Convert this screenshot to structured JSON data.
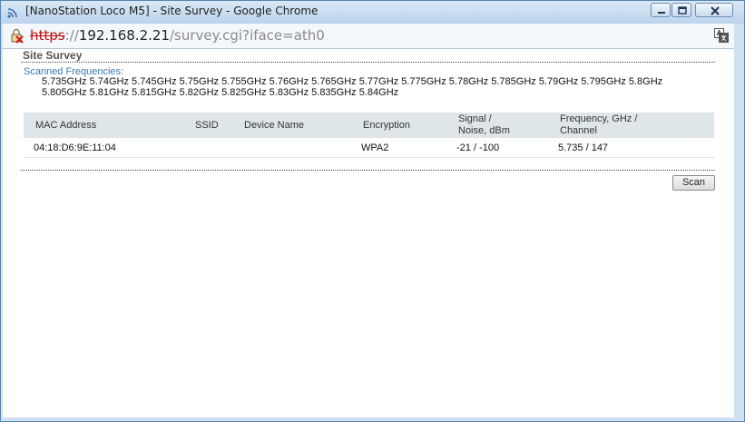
{
  "window": {
    "title": "[NanoStation Loco M5] - Site Survey - Google Chrome"
  },
  "address": {
    "scheme": "https",
    "separator": "://",
    "host": "192.168.2.21",
    "path": "/survey.cgi?iface=ath0"
  },
  "page": {
    "section_title": "Site Survey",
    "scanned_label": "Scanned Frequencies:",
    "frequencies": "5.735GHz 5.74GHz 5.745GHz 5.75GHz 5.755GHz 5.76GHz 5.765GHz 5.77GHz 5.775GHz 5.78GHz 5.785GHz 5.79GHz 5.795GHz 5.8GHz 5.805GHz 5.81GHz 5.815GHz 5.82GHz 5.825GHz 5.83GHz 5.835GHz 5.84GHz"
  },
  "table": {
    "headers": {
      "mac": "MAC Address",
      "ssid": "SSID",
      "device": "Device Name",
      "encryption": "Encryption",
      "signal_l1": "Signal /",
      "signal_l2": "Noise, dBm",
      "freq_l1": "Frequency, GHz /",
      "freq_l2": "Channel"
    },
    "rows": [
      {
        "mac": "04:18:D6:9E:11:04",
        "ssid": "",
        "device": "",
        "encryption": "WPA2",
        "signal": "-21 / -100",
        "frequency": "5.735 / 147"
      }
    ]
  },
  "actions": {
    "scan_label": "Scan"
  },
  "colors": {
    "titlebar": "#bcd3ec",
    "url_scheme_error": "#c01010",
    "label_blue": "#3a78b5",
    "table_header": "#dfe6ea"
  },
  "icons": {
    "title": "wifi-signal-icon",
    "security": "broken-lock-icon",
    "translate": "translate-icon"
  }
}
